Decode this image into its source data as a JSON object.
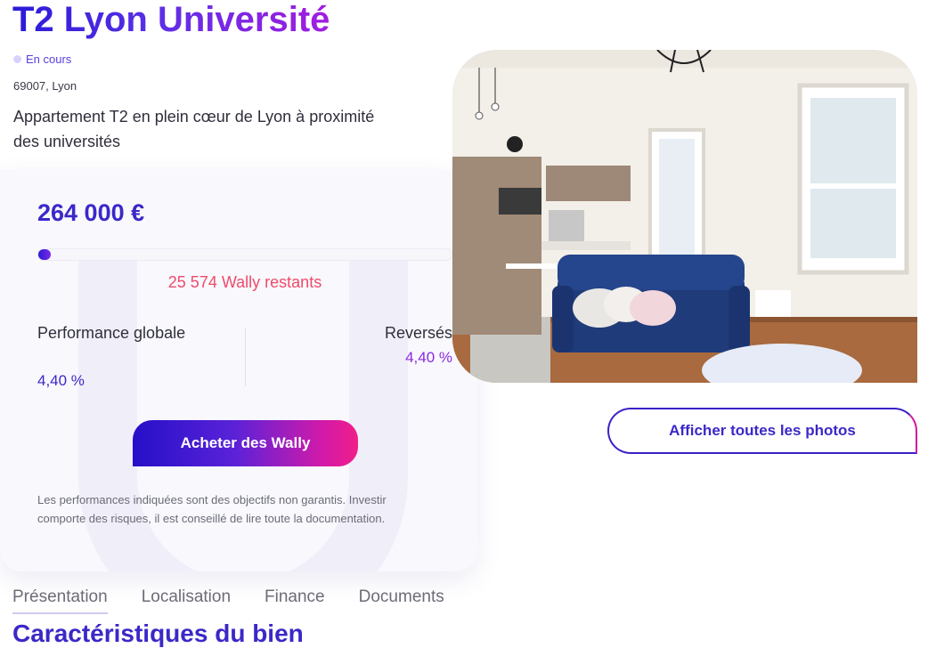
{
  "listing": {
    "title": "T2 Lyon Université",
    "status": "En cours",
    "location": "69007, Lyon",
    "description": "Appartement T2 en plein cœur de Lyon à proximité des universités"
  },
  "investment_card": {
    "price": "264 000 €",
    "progress_fraction": 0.03,
    "remaining": "25 574 Wally restants",
    "performance_label": "Performance globale",
    "performance_value": "4,40 %",
    "reverse_label": "Reversés",
    "reverse_value": "4,40 %",
    "buy_button": "Acheter des Wally",
    "disclaimer": "Les performances indiquées sont des objectifs non garantis. Investir comporte des risques, il est conseillé de lire toute la documentation."
  },
  "gallery": {
    "show_all_button": "Afficher toutes les photos"
  },
  "tabs": [
    {
      "label": "Présentation",
      "active": true
    },
    {
      "label": "Localisation",
      "active": false
    },
    {
      "label": "Finance",
      "active": false
    },
    {
      "label": "Documents",
      "active": false
    }
  ],
  "section": {
    "title": "Caractéristiques du bien"
  },
  "colors": {
    "brand": "#3b28c8",
    "accent_pink": "#ef4b6a",
    "accent_purple": "#8a2ae0"
  }
}
